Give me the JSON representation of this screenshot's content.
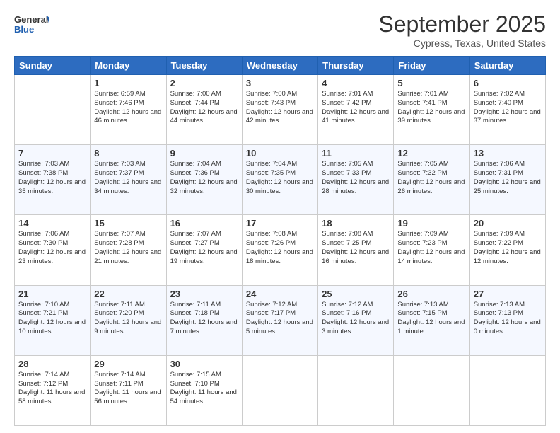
{
  "logo": {
    "line1": "General",
    "line2": "Blue"
  },
  "title": "September 2025",
  "subtitle": "Cypress, Texas, United States",
  "weekdays": [
    "Sunday",
    "Monday",
    "Tuesday",
    "Wednesday",
    "Thursday",
    "Friday",
    "Saturday"
  ],
  "weeks": [
    [
      {
        "num": "",
        "sunrise": "",
        "sunset": "",
        "daylight": ""
      },
      {
        "num": "1",
        "sunrise": "Sunrise: 6:59 AM",
        "sunset": "Sunset: 7:46 PM",
        "daylight": "Daylight: 12 hours and 46 minutes."
      },
      {
        "num": "2",
        "sunrise": "Sunrise: 7:00 AM",
        "sunset": "Sunset: 7:44 PM",
        "daylight": "Daylight: 12 hours and 44 minutes."
      },
      {
        "num": "3",
        "sunrise": "Sunrise: 7:00 AM",
        "sunset": "Sunset: 7:43 PM",
        "daylight": "Daylight: 12 hours and 42 minutes."
      },
      {
        "num": "4",
        "sunrise": "Sunrise: 7:01 AM",
        "sunset": "Sunset: 7:42 PM",
        "daylight": "Daylight: 12 hours and 41 minutes."
      },
      {
        "num": "5",
        "sunrise": "Sunrise: 7:01 AM",
        "sunset": "Sunset: 7:41 PM",
        "daylight": "Daylight: 12 hours and 39 minutes."
      },
      {
        "num": "6",
        "sunrise": "Sunrise: 7:02 AM",
        "sunset": "Sunset: 7:40 PM",
        "daylight": "Daylight: 12 hours and 37 minutes."
      }
    ],
    [
      {
        "num": "7",
        "sunrise": "Sunrise: 7:03 AM",
        "sunset": "Sunset: 7:38 PM",
        "daylight": "Daylight: 12 hours and 35 minutes."
      },
      {
        "num": "8",
        "sunrise": "Sunrise: 7:03 AM",
        "sunset": "Sunset: 7:37 PM",
        "daylight": "Daylight: 12 hours and 34 minutes."
      },
      {
        "num": "9",
        "sunrise": "Sunrise: 7:04 AM",
        "sunset": "Sunset: 7:36 PM",
        "daylight": "Daylight: 12 hours and 32 minutes."
      },
      {
        "num": "10",
        "sunrise": "Sunrise: 7:04 AM",
        "sunset": "Sunset: 7:35 PM",
        "daylight": "Daylight: 12 hours and 30 minutes."
      },
      {
        "num": "11",
        "sunrise": "Sunrise: 7:05 AM",
        "sunset": "Sunset: 7:33 PM",
        "daylight": "Daylight: 12 hours and 28 minutes."
      },
      {
        "num": "12",
        "sunrise": "Sunrise: 7:05 AM",
        "sunset": "Sunset: 7:32 PM",
        "daylight": "Daylight: 12 hours and 26 minutes."
      },
      {
        "num": "13",
        "sunrise": "Sunrise: 7:06 AM",
        "sunset": "Sunset: 7:31 PM",
        "daylight": "Daylight: 12 hours and 25 minutes."
      }
    ],
    [
      {
        "num": "14",
        "sunrise": "Sunrise: 7:06 AM",
        "sunset": "Sunset: 7:30 PM",
        "daylight": "Daylight: 12 hours and 23 minutes."
      },
      {
        "num": "15",
        "sunrise": "Sunrise: 7:07 AM",
        "sunset": "Sunset: 7:28 PM",
        "daylight": "Daylight: 12 hours and 21 minutes."
      },
      {
        "num": "16",
        "sunrise": "Sunrise: 7:07 AM",
        "sunset": "Sunset: 7:27 PM",
        "daylight": "Daylight: 12 hours and 19 minutes."
      },
      {
        "num": "17",
        "sunrise": "Sunrise: 7:08 AM",
        "sunset": "Sunset: 7:26 PM",
        "daylight": "Daylight: 12 hours and 18 minutes."
      },
      {
        "num": "18",
        "sunrise": "Sunrise: 7:08 AM",
        "sunset": "Sunset: 7:25 PM",
        "daylight": "Daylight: 12 hours and 16 minutes."
      },
      {
        "num": "19",
        "sunrise": "Sunrise: 7:09 AM",
        "sunset": "Sunset: 7:23 PM",
        "daylight": "Daylight: 12 hours and 14 minutes."
      },
      {
        "num": "20",
        "sunrise": "Sunrise: 7:09 AM",
        "sunset": "Sunset: 7:22 PM",
        "daylight": "Daylight: 12 hours and 12 minutes."
      }
    ],
    [
      {
        "num": "21",
        "sunrise": "Sunrise: 7:10 AM",
        "sunset": "Sunset: 7:21 PM",
        "daylight": "Daylight: 12 hours and 10 minutes."
      },
      {
        "num": "22",
        "sunrise": "Sunrise: 7:11 AM",
        "sunset": "Sunset: 7:20 PM",
        "daylight": "Daylight: 12 hours and 9 minutes."
      },
      {
        "num": "23",
        "sunrise": "Sunrise: 7:11 AM",
        "sunset": "Sunset: 7:18 PM",
        "daylight": "Daylight: 12 hours and 7 minutes."
      },
      {
        "num": "24",
        "sunrise": "Sunrise: 7:12 AM",
        "sunset": "Sunset: 7:17 PM",
        "daylight": "Daylight: 12 hours and 5 minutes."
      },
      {
        "num": "25",
        "sunrise": "Sunrise: 7:12 AM",
        "sunset": "Sunset: 7:16 PM",
        "daylight": "Daylight: 12 hours and 3 minutes."
      },
      {
        "num": "26",
        "sunrise": "Sunrise: 7:13 AM",
        "sunset": "Sunset: 7:15 PM",
        "daylight": "Daylight: 12 hours and 1 minute."
      },
      {
        "num": "27",
        "sunrise": "Sunrise: 7:13 AM",
        "sunset": "Sunset: 7:13 PM",
        "daylight": "Daylight: 12 hours and 0 minutes."
      }
    ],
    [
      {
        "num": "28",
        "sunrise": "Sunrise: 7:14 AM",
        "sunset": "Sunset: 7:12 PM",
        "daylight": "Daylight: 11 hours and 58 minutes."
      },
      {
        "num": "29",
        "sunrise": "Sunrise: 7:14 AM",
        "sunset": "Sunset: 7:11 PM",
        "daylight": "Daylight: 11 hours and 56 minutes."
      },
      {
        "num": "30",
        "sunrise": "Sunrise: 7:15 AM",
        "sunset": "Sunset: 7:10 PM",
        "daylight": "Daylight: 11 hours and 54 minutes."
      },
      {
        "num": "",
        "sunrise": "",
        "sunset": "",
        "daylight": ""
      },
      {
        "num": "",
        "sunrise": "",
        "sunset": "",
        "daylight": ""
      },
      {
        "num": "",
        "sunrise": "",
        "sunset": "",
        "daylight": ""
      },
      {
        "num": "",
        "sunrise": "",
        "sunset": "",
        "daylight": ""
      }
    ]
  ]
}
